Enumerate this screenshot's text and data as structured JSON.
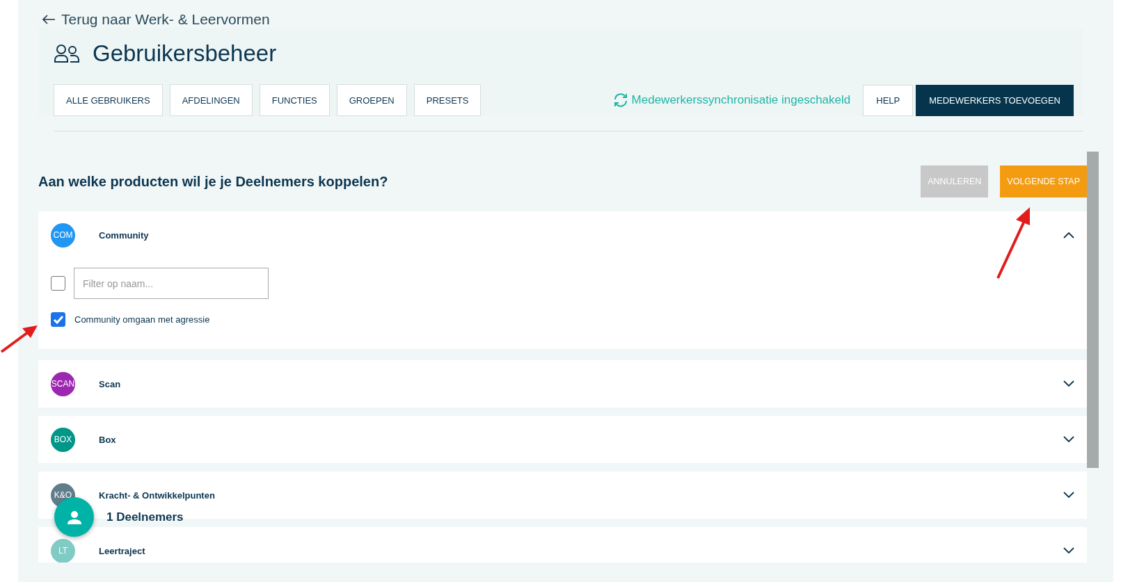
{
  "back_link": "Terug naar Werk- & Leervormen",
  "page": {
    "title": "Gebruikersbeheer"
  },
  "nav_buttons": [
    "ALLE GEBRUIKERS",
    "AFDELINGEN",
    "FUNCTIES",
    "GROEPEN",
    "PRESETS"
  ],
  "sync_status": "Medewerkerssynchronisatie ingeschakeld",
  "actions": [
    {
      "label": "HELP",
      "kind": "secondary"
    },
    {
      "label": "MEDEWERKERS TOEVOEGEN",
      "kind": "primary"
    }
  ],
  "question": "Aan welke producten wil je je Deelnemers koppelen?",
  "step_buttons": [
    {
      "label": "ANNULEREN",
      "disabled": true
    },
    {
      "label": "VOLGENDE STAP",
      "disabled": false
    }
  ],
  "products": [
    {
      "badge": "COM",
      "name": "Community",
      "color": "#2196f3",
      "expanded": true,
      "filter": {
        "placeholder": "Filter op naam...",
        "checked": false
      },
      "items": [
        {
          "label": "Community omgaan met agressie",
          "checked": true
        }
      ]
    },
    {
      "badge": "SCAN",
      "name": "Scan",
      "color": "#9c27b0",
      "expanded": false
    },
    {
      "badge": "BOX",
      "name": "Box",
      "color": "#009688",
      "expanded": false
    },
    {
      "badge": "K&O",
      "name": "Kracht- & Ontwikkelpunten",
      "color": "#607d8b",
      "expanded": false
    },
    {
      "badge": "LT",
      "name": "Leertraject",
      "color": "#80cbc4",
      "expanded": false
    }
  ],
  "participants": {
    "count_label": "1 Deelnemers"
  }
}
